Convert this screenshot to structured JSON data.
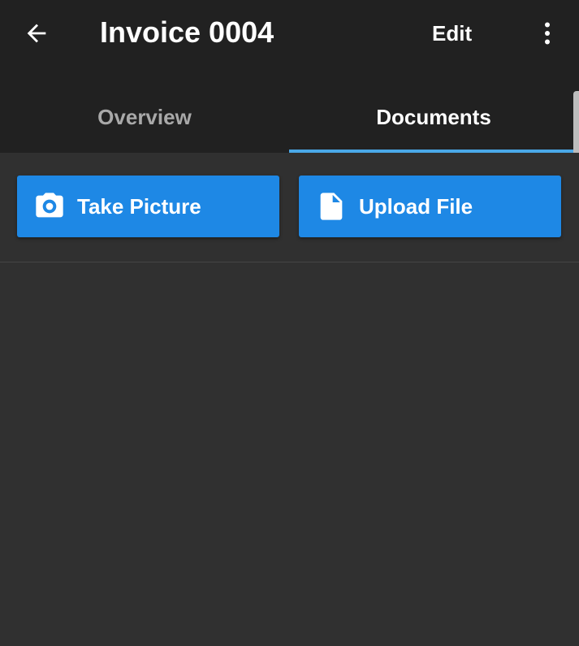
{
  "header": {
    "back_icon": "arrow-left-icon",
    "title": "Invoice 0004",
    "edit_label": "Edit",
    "more_icon": "more-vertical-icon"
  },
  "tabs": [
    {
      "label": "Overview",
      "active": false
    },
    {
      "label": "Documents",
      "active": true
    }
  ],
  "actions": {
    "take_picture": {
      "label": "Take Picture",
      "icon": "camera-icon"
    },
    "upload_file": {
      "label": "Upload File",
      "icon": "file-icon"
    }
  },
  "colors": {
    "appbar": "#212121",
    "background": "#303030",
    "accent": "#1e88e5",
    "tab_indicator": "#4aa8e8"
  }
}
